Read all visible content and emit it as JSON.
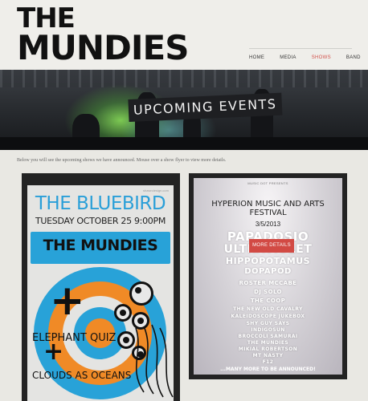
{
  "header": {
    "logo_line1": "THE",
    "logo_line2": "MUNDIES",
    "nav": [
      {
        "label": "HOME",
        "active": false
      },
      {
        "label": "MEDIA",
        "active": false
      },
      {
        "label": "SHOWS",
        "active": true
      },
      {
        "label": "BAND",
        "active": false
      }
    ],
    "accent_color": "#d2504a"
  },
  "banner": {
    "title": "UPCOMING EVENTS"
  },
  "intro": "Below you will see the upcoming shows we have announced. Mouse over a show flyer to view more details.",
  "flyers": [
    {
      "credit": "shawndesign.com",
      "venue": "THE BLUEBIRD",
      "date": "TUESDAY OCTOBER 25 9:00PM",
      "headliner": "THE MUNDIES",
      "plus1": "+",
      "support1": "ELEPHANT QUIZ",
      "plus2": "+",
      "support2": "CLOUDS AS OCEANS",
      "colors": {
        "blue": "#28a2d8",
        "orange": "#f08a26"
      }
    },
    {
      "presents": "MUSIC DOT PRESENTS",
      "title": "HYPERION MUSIC AND ARTS FESTIVAL",
      "date": "3/5/2013",
      "button_label": "MORE DETAILS →",
      "lineup_large": [
        "PAPADOSIO",
        "ULTRAVIOLET",
        "HIPPOPOTAMUS",
        "DOPAPOD"
      ],
      "lineup_small": [
        "ROSTER MCCABE",
        "DJ SOLO",
        "THE COOP",
        "THE NEW OLD CAVALRY",
        "KALEIDOSCOPE JUKEBOX",
        "SHY GUY SAYS",
        "INDIGOSUN",
        "BROCCOLI SAMURAI",
        "THE MUNDIES",
        "MIKIAL ROBERTSON",
        "MT NASTY",
        "F12"
      ],
      "footer": "...MANY MORE TO BE ANNOUNCED!"
    }
  ]
}
